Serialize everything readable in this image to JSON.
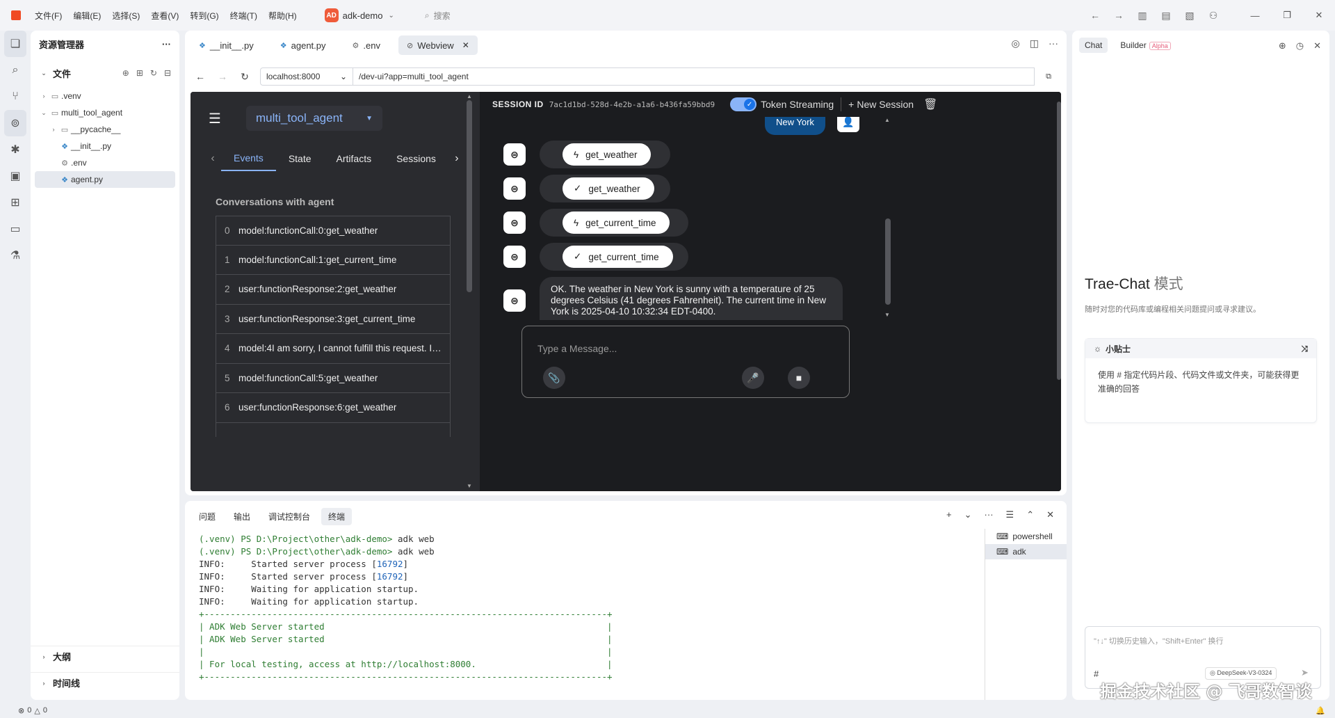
{
  "titlebar": {
    "menus": [
      "文件(F)",
      "编辑(E)",
      "选择(S)",
      "查看(V)",
      "转到(G)",
      "终端(T)",
      "帮助(H)"
    ],
    "project_badge": "AD",
    "project_name": "adk-demo",
    "search_placeholder": "搜索"
  },
  "sidebar": {
    "title": "资源管理器",
    "files_section": "文件",
    "tree": [
      {
        "label": ".venv",
        "type": "folder",
        "depth": 0
      },
      {
        "label": "multi_tool_agent",
        "type": "folder-open",
        "depth": 0
      },
      {
        "label": "__pycache__",
        "type": "folder",
        "depth": 1
      },
      {
        "label": "__init__.py",
        "type": "py",
        "depth": 1
      },
      {
        "label": ".env",
        "type": "gear",
        "depth": 1
      },
      {
        "label": "agent.py",
        "type": "py",
        "depth": 1,
        "active": true
      }
    ],
    "outline": "大纲",
    "timeline": "时间线"
  },
  "editor": {
    "tabs": [
      {
        "label": "__init__.py",
        "icon": "py-icon"
      },
      {
        "label": "agent.py",
        "icon": "py-icon"
      },
      {
        "label": ".env",
        "icon": "gear-icon"
      },
      {
        "label": "Webview",
        "icon": "webview-icon",
        "active": true
      }
    ],
    "host": "localhost:8000",
    "path": "/dev-ui?app=multi_tool_agent"
  },
  "webapp": {
    "agent_name": "multi_tool_agent",
    "tabs": [
      "Events",
      "State",
      "Artifacts",
      "Sessions"
    ],
    "active_tab": "Events",
    "conversations_title": "Conversations with agent",
    "events": [
      {
        "idx": "0",
        "text": "model:functionCall:0:get_weather"
      },
      {
        "idx": "1",
        "text": "model:functionCall:1:get_current_time"
      },
      {
        "idx": "2",
        "text": "user:functionResponse:2:get_weather"
      },
      {
        "idx": "3",
        "text": "user:functionResponse:3:get_current_time"
      },
      {
        "idx": "4",
        "text": "model:4I am sorry, I cannot fulfill this request. I do no…"
      },
      {
        "idx": "5",
        "text": "model:functionCall:5:get_weather"
      },
      {
        "idx": "6",
        "text": "user:functionResponse:6:get_weather"
      }
    ],
    "session_label": "SESSION ID",
    "session_id": "7ac1d1bd-528d-4e2b-a1a6-b436fa59bbd9",
    "token_streaming": "Token Streaming",
    "new_session": "New Session",
    "user_message": "New York",
    "function_chips": [
      {
        "label": "get_weather",
        "kind": "call"
      },
      {
        "label": "get_weather",
        "kind": "response"
      },
      {
        "label": "get_current_time",
        "kind": "call"
      },
      {
        "label": "get_current_time",
        "kind": "response"
      }
    ],
    "bot_reply": "OK. The weather in New York is sunny with a temperature of 25 degrees Celsius (41 degrees Fahrenheit). The current time in New York is 2025-04-10 10:32:34 EDT-0400.",
    "input_placeholder": "Type a Message..."
  },
  "panel": {
    "tabs": [
      "问题",
      "输出",
      "调试控制台",
      "终端"
    ],
    "active_tab": "终端",
    "terminal_lines": [
      {
        "kind": "prompt",
        "prefix": "(.venv) PS D:\\Project\\other\\adk-demo>",
        "cmd": " adk web"
      },
      {
        "kind": "prompt",
        "prefix": "(.venv) PS D:\\Project\\other\\adk-demo>",
        "cmd": " adk web"
      },
      {
        "kind": "info",
        "prefix": "INFO:     Started server process [",
        "num": "16792",
        "suffix": "]"
      },
      {
        "kind": "info",
        "prefix": "INFO:     Started server process [",
        "num": "16792",
        "suffix": "]"
      },
      {
        "kind": "plain",
        "text": "INFO:     Waiting for application startup."
      },
      {
        "kind": "plain",
        "text": "INFO:     Waiting for application startup."
      },
      {
        "kind": "box",
        "text": "+-----------------------------------------------------------------------------+"
      },
      {
        "kind": "box",
        "text": "| ADK Web Server started                                                      |"
      },
      {
        "kind": "box",
        "text": "| ADK Web Server started                                                      |"
      },
      {
        "kind": "box",
        "text": "|                                                                             |"
      },
      {
        "kind": "box",
        "text": "| For local testing, access at http://localhost:8000.                         |"
      },
      {
        "kind": "box",
        "text": "+-----------------------------------------------------------------------------+"
      }
    ],
    "terminals": [
      "powershell",
      "adk"
    ],
    "active_terminal": "adk"
  },
  "rightpanel": {
    "tabs": [
      "Chat",
      "Builder"
    ],
    "alpha": "Alpha",
    "title": "Trae-Chat",
    "title_suffix": "模式",
    "subtitle": "随时对您的代码库或编程相关问题提问或寻求建议。",
    "tip_title": "小贴士",
    "tip_body": "使用 # 指定代码片段、代码文件或文件夹，可能获得更准确的回答",
    "input_placeholder": "\"↑↓\" 切换历史输入，\"Shift+Enter\" 换行",
    "hash": "#",
    "model": "DeepSeek-V3-0324"
  },
  "statusbar": {
    "errors": "0",
    "warnings": "0"
  },
  "watermark": "掘金技术社区 @ 飞哥数智谈",
  "colors": {
    "accent": "#8ab4f8",
    "user_bubble": "#104f8a",
    "dark_bg": "#1b1c1f",
    "brand": "#f04a23"
  }
}
